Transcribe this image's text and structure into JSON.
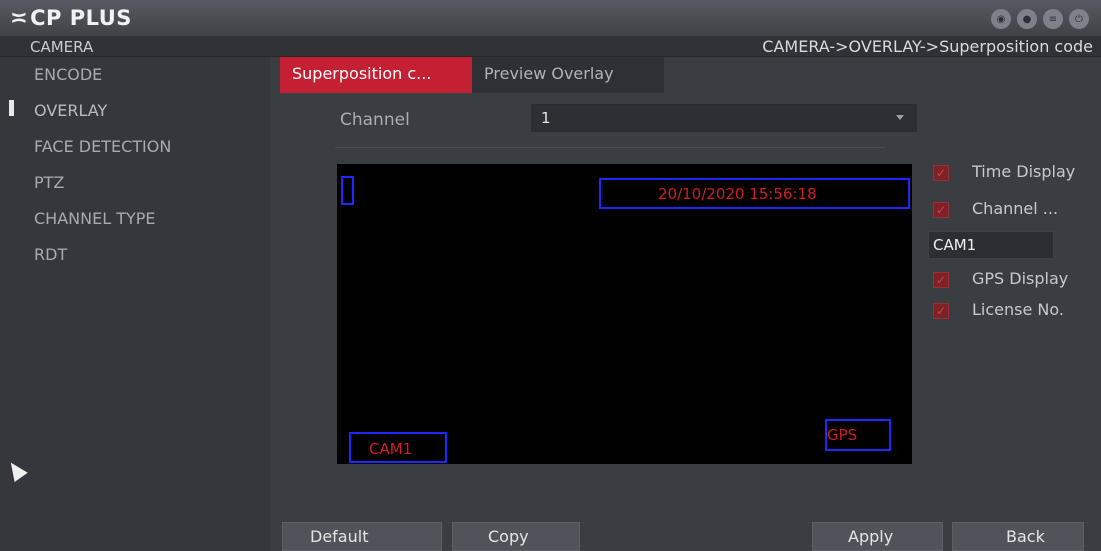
{
  "header": {
    "logo_mark": "≍",
    "logo_text": "CP PLUS"
  },
  "top_icons": [
    {
      "name": "eye-icon",
      "glyph": "◉"
    },
    {
      "name": "user-icon",
      "glyph": "●"
    },
    {
      "name": "list-icon",
      "glyph": "≡"
    },
    {
      "name": "power-icon",
      "glyph": "⏻"
    }
  ],
  "section": {
    "title": "CAMERA",
    "breadcrumb": "CAMERA->OVERLAY->Superposition code"
  },
  "sidebar": {
    "items": [
      {
        "label": "ENCODE"
      },
      {
        "label": "OVERLAY"
      },
      {
        "label": "FACE DETECTION"
      },
      {
        "label": "PTZ"
      },
      {
        "label": "CHANNEL TYPE"
      },
      {
        "label": "RDT"
      }
    ],
    "active": "OVERLAY"
  },
  "tabs": [
    {
      "label": "Superposition c..."
    },
    {
      "label": "Preview Overlay"
    }
  ],
  "channel": {
    "label": "Channel",
    "value": "1"
  },
  "preview": {
    "time_text": "20/10/2020 15:56:18",
    "cam_text": "CAM1",
    "gps_text": "GPS"
  },
  "options": {
    "time_display": {
      "label": "Time Display",
      "checked": true
    },
    "channel_title": {
      "label": "Channel ...",
      "checked": true
    },
    "channel_name": "CAM1",
    "gps_display": {
      "label": "GPS Display",
      "checked": true
    },
    "license_no": {
      "label": "License No.",
      "checked": true
    }
  },
  "buttons": {
    "default": "Default",
    "copy": "Copy",
    "apply": "Apply",
    "back": "Back"
  },
  "colors": {
    "accent": "#c41f33",
    "overlay_box": "#1c28ff",
    "overlay_text": "#d11f1f",
    "checkbox": "#7e2228"
  }
}
